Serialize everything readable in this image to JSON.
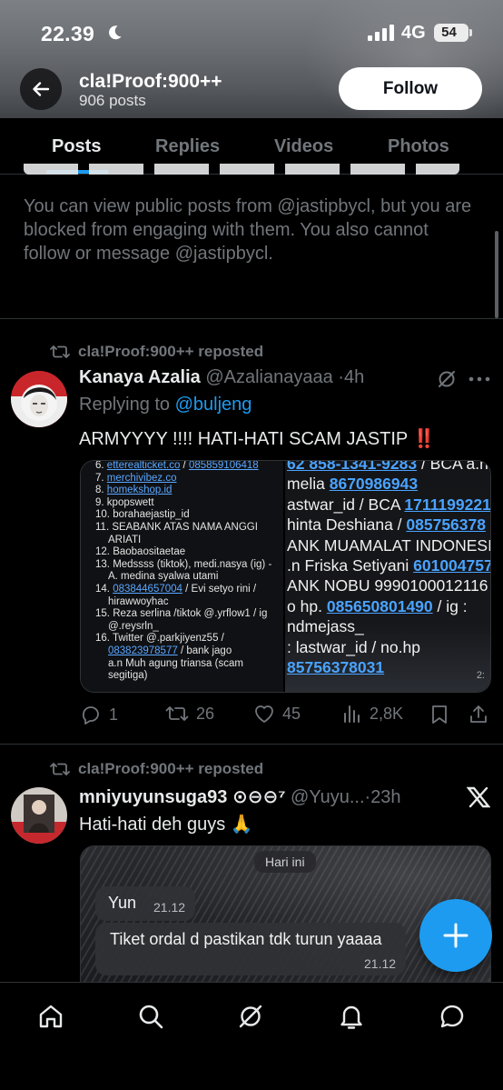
{
  "status_bar": {
    "time": "22.39",
    "network": "4G",
    "battery": "54"
  },
  "header": {
    "profile_name": "cla!Proof:900++",
    "posts_count": "906 posts",
    "follow_label": "Follow"
  },
  "tabs": [
    {
      "label": "Posts",
      "active": true
    },
    {
      "label": "Replies",
      "active": false
    },
    {
      "label": "Videos",
      "active": false
    },
    {
      "label": "Photos",
      "active": false
    }
  ],
  "blocked_notice": {
    "text": "You can view public posts from @jastipbycl, but you are blocked from engaging with them. You also cannot follow or message @jastipbycl."
  },
  "posts": [
    {
      "repost_label": "cla!Proof:900++ reposted",
      "display_name": "Kanaya Azalia",
      "handle": "@Azalianayaaa",
      "time": "4h",
      "replying_prefix": "Replying to",
      "replying_to": "@buljeng",
      "text": "ARMYYYY !!!! HATI-HATI SCAM JASTIP ‼️",
      "media_left_lines": [
        [
          "6.",
          "etterealticket.co",
          " / ",
          "085859106418"
        ],
        [
          "7.",
          "merchivibez.co"
        ],
        [
          "8.",
          "homekshop.id"
        ],
        [
          "9.",
          "kpopswett"
        ],
        [
          "10.",
          "borahaejastip_id"
        ],
        [
          "11.",
          "SEABANK ATAS NAMA ANGGI"
        ],
        [
          "",
          "ARIATI"
        ],
        [
          "12.",
          "Baobaositaetae"
        ],
        [
          "13.",
          "Medssss (tiktok), medi.nasya (ig) -"
        ],
        [
          "",
          "A. medina syalwa utami"
        ],
        [
          "14.",
          "083844657004",
          " / Evi setyo rini /"
        ],
        [
          "",
          "hirawwoyhac"
        ],
        [
          "15.",
          "Reza serlina /tiktok @.yrflow1 / ig"
        ],
        [
          "",
          "@.reysrln_"
        ],
        [
          "16.",
          "Twitter @.parkjiyenz55 /"
        ],
        [
          "",
          "083823978577",
          " / bank jago"
        ],
        [
          "",
          "a.n Muh agung triansa (scam"
        ],
        [
          "",
          "segitiga)"
        ]
      ],
      "media_right_lines": [
        [
          "",
          "62 858-1341-9283",
          " / BCA a.n"
        ],
        [
          "melia ",
          "8670986943"
        ],
        [
          "astwar_id / BCA ",
          "1711199221"
        ],
        [
          "hinta Deshiana / ",
          "085756378"
        ],
        [
          "ANK MUAMALAT INDONESIA"
        ],
        [
          ".n Friska Setiyani ",
          "601004757"
        ],
        [
          "ANK NOBU 9990100012116"
        ],
        [
          "o hp. ",
          "085650801490",
          " / ig :"
        ],
        [
          "ndmejass_"
        ],
        [
          ": lastwar_id / no.hp"
        ],
        [
          "",
          "85756378031"
        ]
      ],
      "media_corner": "2:",
      "replies": "1",
      "reposts": "26",
      "likes": "45",
      "views": "2,8K"
    },
    {
      "repost_label": "cla!Proof:900++ reposted",
      "display_name": "mniyuyunsuga93",
      "name_suffix": "⊙⊖⊖⁷",
      "handle": "@Yuyu...",
      "time": "23h",
      "text": "Hati-hati deh guys 🙏",
      "chat": {
        "date_chip": "Hari ini",
        "bubble1_text": "Yun",
        "bubble1_time": "21.12",
        "bubble2_text": "Tiket ordal d pastikan tdk turun yaaaa",
        "bubble2_time": "21.12"
      }
    }
  ],
  "colors": {
    "accent": "#1d9bf0",
    "muted": "#71767b",
    "text": "#e7e9ea",
    "background": "#000000"
  },
  "icons": {
    "back": "arrow-left-icon",
    "fab": "plus-icon",
    "nav": [
      "home-icon",
      "search-icon",
      "grok-icon",
      "notifications-icon",
      "messages-icon"
    ]
  }
}
